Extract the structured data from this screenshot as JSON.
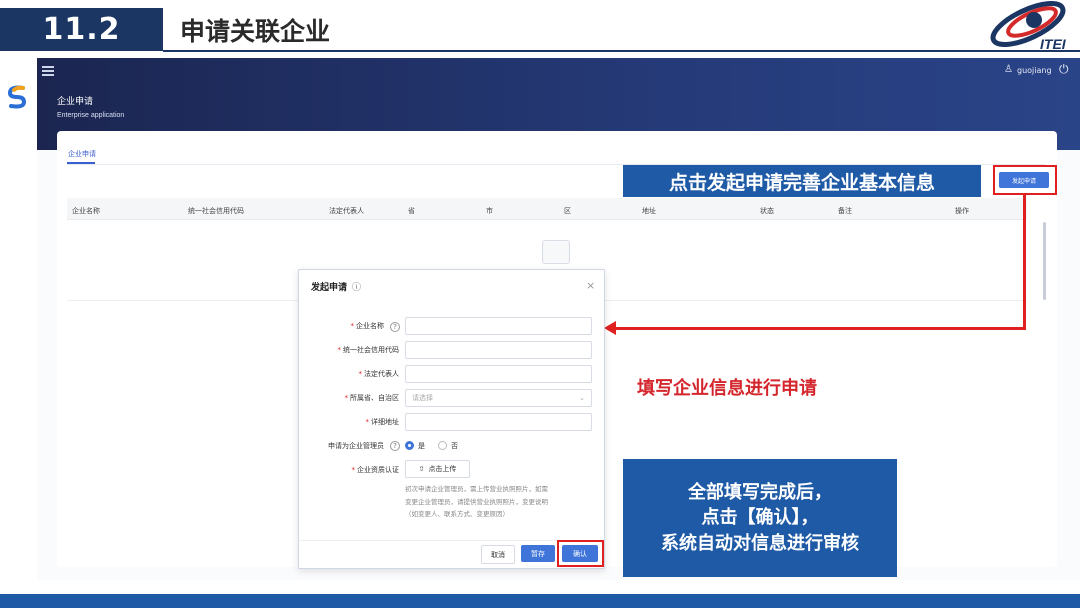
{
  "slide": {
    "section_number": "11.2",
    "title": "申请关联企业",
    "logo_text": "ITEI"
  },
  "app": {
    "user_name": "guojiang",
    "page_title": "企业申请",
    "page_subtitle": "Enterprise application",
    "tab_label": "企业申请",
    "apply_button": "发起申请",
    "table_columns": [
      "企业名称",
      "统一社会信用代码",
      "法定代表人",
      "省",
      "市",
      "区",
      "地址",
      "状态",
      "备注",
      "操作"
    ]
  },
  "dialog": {
    "title": "发起申请",
    "fields": {
      "company_name": "企业名称",
      "credit_code": "统一社会信用代码",
      "legal_rep": "法定代表人",
      "province": "所属省、自治区",
      "province_placeholder": "请选择",
      "address": "详细地址",
      "admin_question": "申请为企业管理员",
      "admin_yes": "是",
      "admin_no": "否",
      "qualification": "企业资质认证",
      "upload_button": "点击上传",
      "hint_line1": "初次申请企业管理员，需上传营业执照照片，如需",
      "hint_line2": "变更企业管理员，请提供营业执照照片，变更说明",
      "hint_line3": "（如变更人、联系方式、变更原因）"
    },
    "buttons": {
      "cancel": "取消",
      "save": "暂存",
      "confirm": "确认"
    }
  },
  "annotations": {
    "callout_top": "点击发起申请完善企业基本信息",
    "red_note": "填写企业信息进行申请",
    "callout_bottom_line1": "全部填写完成后，",
    "callout_bottom_line2": "点击【确认】，",
    "callout_bottom_line3": "系统自动对信息进行审核"
  },
  "colors": {
    "navy": "#1c3664",
    "accent_blue": "#1f5aa6",
    "button_blue": "#3f74d9",
    "annotation_red": "#e02020"
  }
}
